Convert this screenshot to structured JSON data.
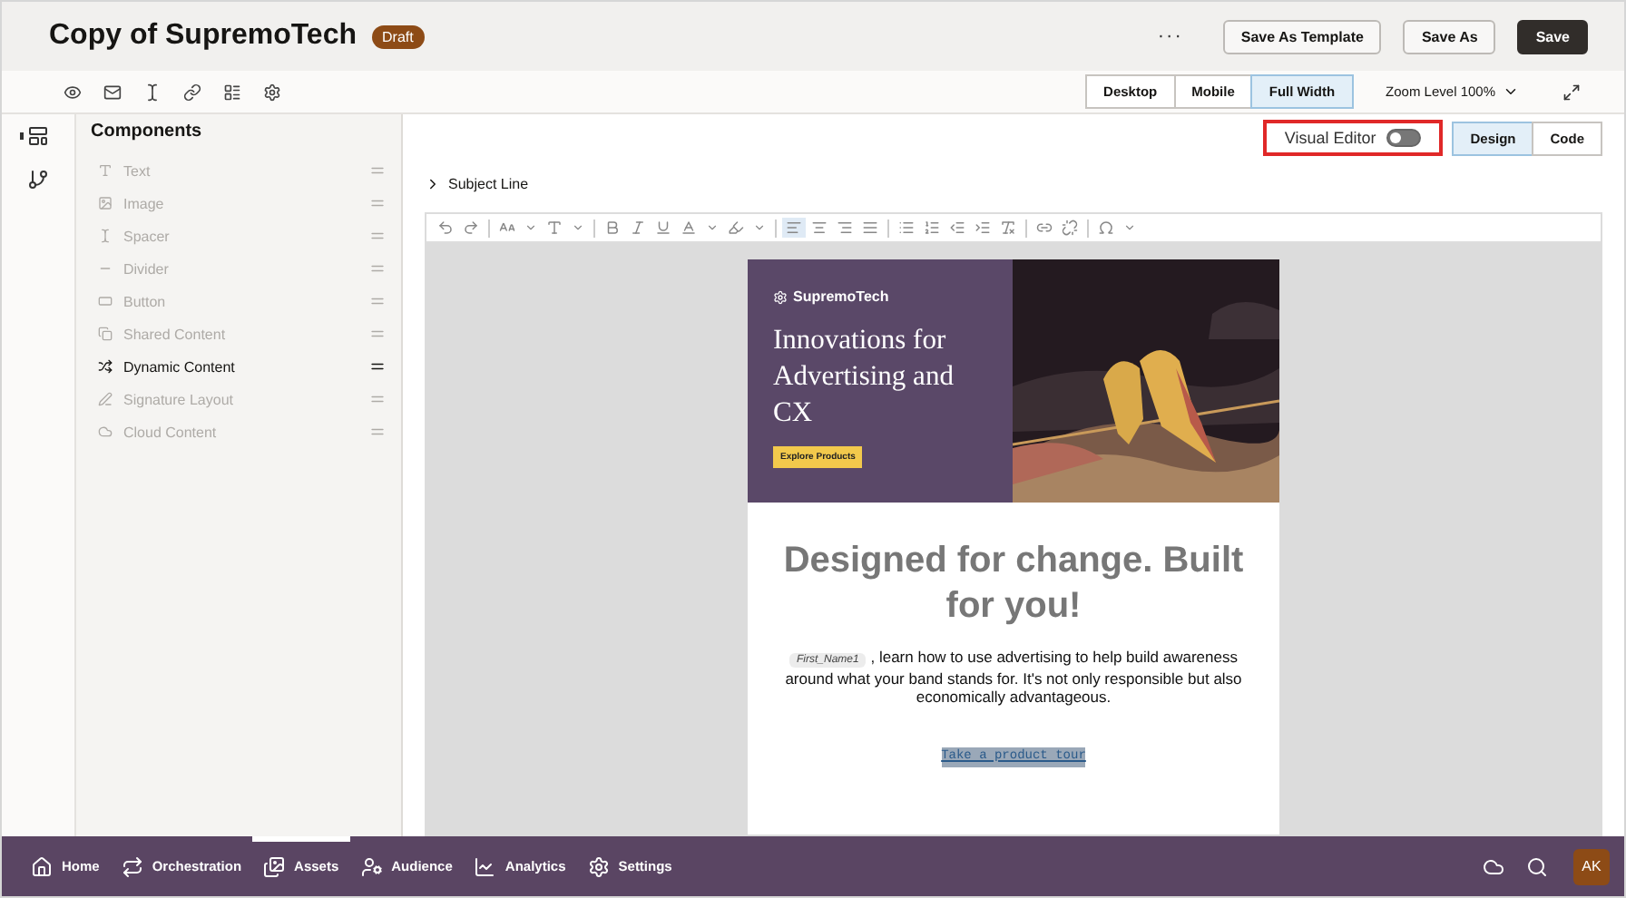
{
  "header": {
    "title": "Copy of SupremoTech",
    "badge": "Draft",
    "more": "···",
    "buttons": [
      {
        "label": "Save As Template",
        "kind": "secondary"
      },
      {
        "label": "Save As",
        "kind": "secondary"
      },
      {
        "label": "Save",
        "kind": "primary"
      }
    ]
  },
  "view_tabs": [
    {
      "label": "Desktop",
      "selected": false
    },
    {
      "label": "Mobile",
      "selected": false
    },
    {
      "label": "Full Width",
      "selected": true
    }
  ],
  "zoom": {
    "label": "Zoom Level 100%"
  },
  "components": {
    "title": "Components",
    "items": [
      {
        "label": "Text",
        "disabled": true
      },
      {
        "label": "Image",
        "disabled": true
      },
      {
        "label": "Spacer",
        "disabled": true
      },
      {
        "label": "Divider",
        "disabled": true
      },
      {
        "label": "Button",
        "disabled": true
      },
      {
        "label": "Shared Content",
        "disabled": true
      },
      {
        "label": "Dynamic Content",
        "disabled": false
      },
      {
        "label": "Signature Layout",
        "disabled": true
      },
      {
        "label": "Cloud Content",
        "disabled": true
      }
    ]
  },
  "visual_editor": {
    "label": "Visual Editor",
    "on": false,
    "highlighted": true
  },
  "mode_tabs": [
    {
      "label": "Design",
      "selected": true
    },
    {
      "label": "Code",
      "selected": false
    }
  ],
  "subject_line": {
    "label": "Subject Line",
    "expanded": false
  },
  "email": {
    "brand": "SupremoTech",
    "hero_title": "Innovations for Advertising and CX",
    "hero_button": "Explore Products",
    "headline": "Designed for change. Built for you!",
    "merge_field": "First_Name1",
    "body": ", learn how to use advertising to help build awareness around what your band stands for. It's not only responsible but also economically advantageous.",
    "link": "Take a product tour"
  },
  "nav": {
    "items": [
      {
        "label": "Home",
        "selected": false
      },
      {
        "label": "Orchestration",
        "selected": false
      },
      {
        "label": "Assets",
        "selected": true
      },
      {
        "label": "Audience",
        "selected": false
      },
      {
        "label": "Analytics",
        "selected": false
      },
      {
        "label": "Settings",
        "selected": false
      }
    ],
    "avatar": "AK"
  }
}
